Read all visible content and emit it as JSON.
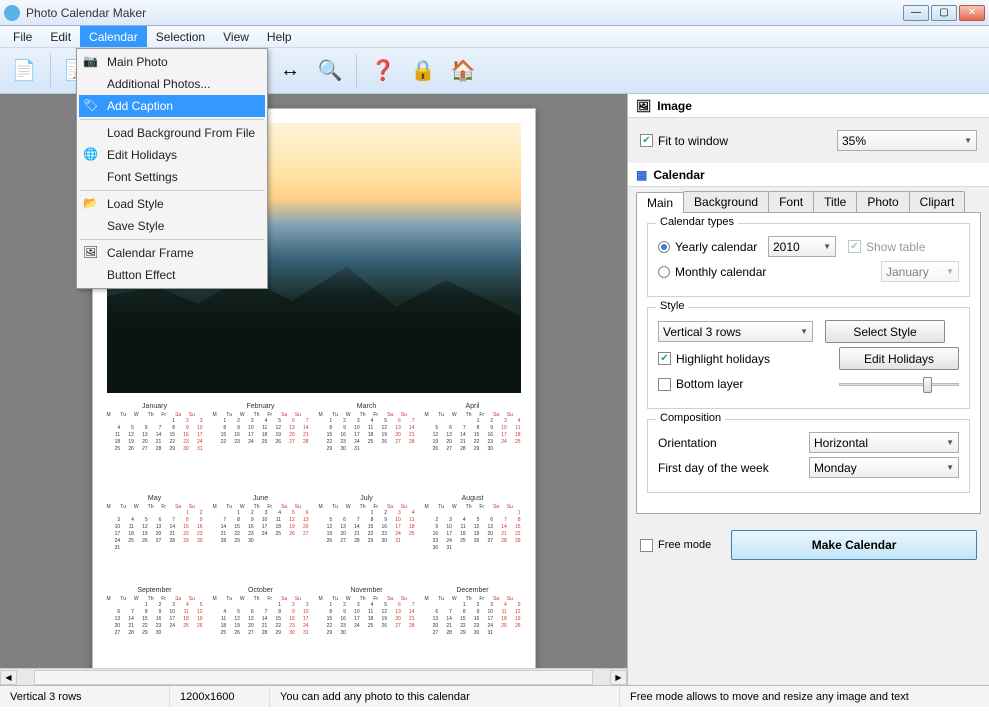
{
  "window": {
    "title": "Photo Calendar Maker"
  },
  "menubar": [
    "File",
    "Edit",
    "Calendar",
    "Selection",
    "View",
    "Help"
  ],
  "dropdown": {
    "items": [
      {
        "label": "Main Photo",
        "icon": "camera"
      },
      {
        "label": "Additional Photos...",
        "icon": ""
      },
      {
        "label": "Add Caption",
        "icon": "caption",
        "hl": true
      },
      {
        "sep": true
      },
      {
        "label": "Load Background From File",
        "icon": ""
      },
      {
        "label": "Edit Holidays",
        "icon": "globe"
      },
      {
        "label": "Font Settings",
        "icon": ""
      },
      {
        "sep": true
      },
      {
        "label": "Load Style",
        "icon": "folder"
      },
      {
        "label": "Save Style",
        "icon": ""
      },
      {
        "sep": true
      },
      {
        "label": "Calendar Frame",
        "icon": "frame"
      },
      {
        "label": "Button Effect",
        "icon": ""
      }
    ]
  },
  "toolbar_names": [
    "new-page",
    "note",
    "font",
    "globe",
    "image",
    "move",
    "arrows",
    "zoom",
    "help",
    "lock",
    "home"
  ],
  "side": {
    "image_header": "Image",
    "fit_label": "Fit to window",
    "fit_checked": true,
    "zoom": "35%",
    "calendar_header": "Calendar",
    "tabs": [
      "Main",
      "Background",
      "Font",
      "Title",
      "Photo",
      "Clipart"
    ],
    "types_label": "Calendar types",
    "yearly": "Yearly calendar",
    "monthly": "Monthly calendar",
    "year": "2010",
    "month": "January",
    "show_table": "Show table",
    "style_label": "Style",
    "style_value": "Vertical 3 rows",
    "select_style": "Select Style",
    "hl_holidays": "Highlight holidays",
    "edit_holidays": "Edit Holidays",
    "bottom_layer": "Bottom layer",
    "composition": "Composition",
    "orientation": "Orientation",
    "orientation_val": "Horizontal",
    "firstday": "First day of the week",
    "firstday_val": "Monday",
    "free_mode": "Free mode",
    "make": "Make Calendar"
  },
  "status": {
    "c1": "Vertical 3 rows",
    "c2": "1200x1600",
    "c3": "You can add any photo to this calendar",
    "c4": "Free mode allows to move and resize any image and text"
  },
  "months": [
    {
      "name": "January",
      "start": 4,
      "days": 31
    },
    {
      "name": "February",
      "start": 0,
      "days": 28
    },
    {
      "name": "March",
      "start": 0,
      "days": 31
    },
    {
      "name": "April",
      "start": 3,
      "days": 30
    },
    {
      "name": "May",
      "start": 5,
      "days": 31
    },
    {
      "name": "June",
      "start": 1,
      "days": 30
    },
    {
      "name": "July",
      "start": 3,
      "days": 31
    },
    {
      "name": "August",
      "start": 6,
      "days": 31
    },
    {
      "name": "September",
      "start": 2,
      "days": 30
    },
    {
      "name": "October",
      "start": 4,
      "days": 31
    },
    {
      "name": "November",
      "start": 0,
      "days": 30
    },
    {
      "name": "December",
      "start": 2,
      "days": 31
    }
  ],
  "dayhead": [
    "M",
    "Tu",
    "W",
    "Th",
    "Fr",
    "Sa",
    "Su"
  ]
}
